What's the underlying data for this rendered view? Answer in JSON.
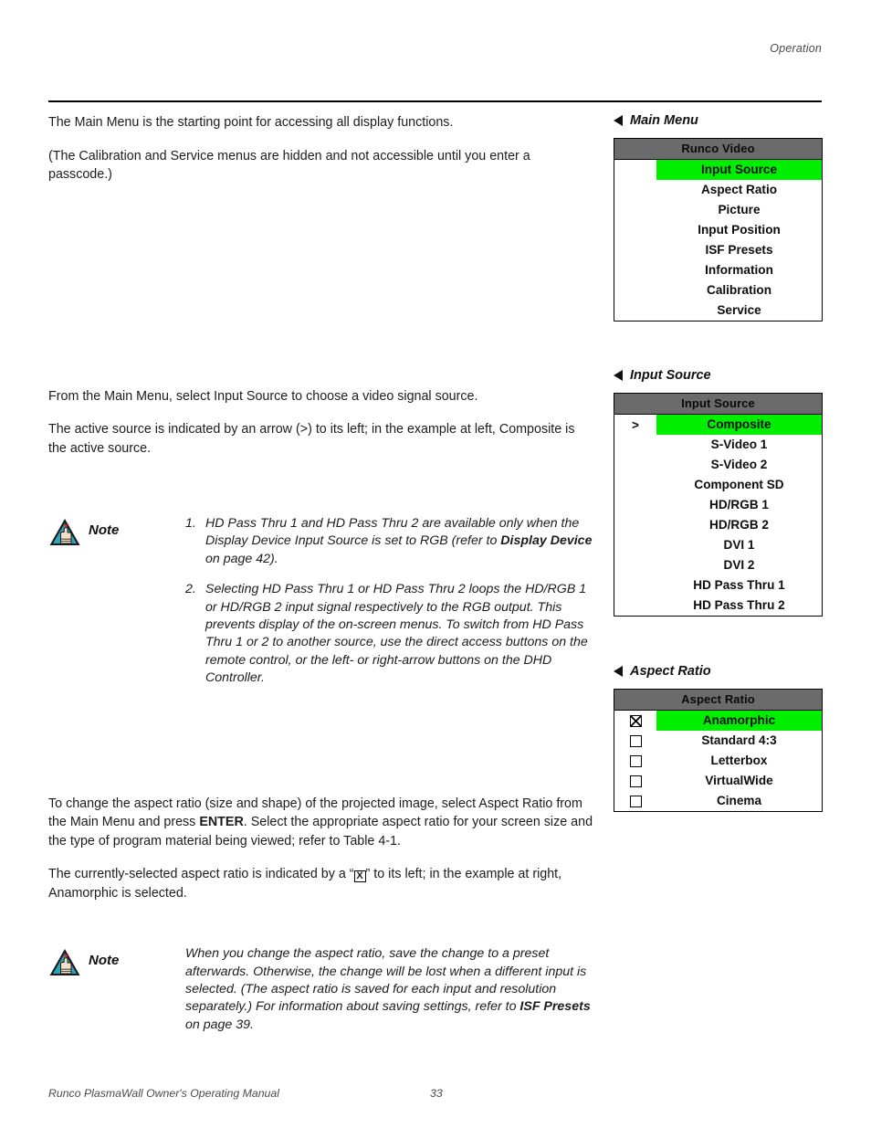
{
  "header": {
    "running_head": "Operation"
  },
  "footer": {
    "manual_title": "Runco PlasmaWall Owner's Operating Manual",
    "page_number": "33"
  },
  "left_column": {
    "para_main_menu_1": "The Main Menu is the starting point for accessing all display functions.",
    "para_main_menu_2": "(The Calibration and Service menus are hidden and not accessible until you enter a passcode.)",
    "para_input_source_1": "From the Main Menu, select Input Source to choose a video signal source.",
    "para_input_source_2": "The active source is indicated by an arrow (>) to its left; in the example at left, Composite is the active source.",
    "note_input_source": {
      "label": "Note",
      "items": [
        {
          "number": "1.",
          "text_before": "HD Pass Thru 1 and HD Pass Thru 2 are available only when the Display Device Input Source is set to RGB (refer to ",
          "bold": "Display Device",
          "text_after": " on page 42)."
        },
        {
          "number": "2.",
          "text_before": "Selecting HD Pass Thru 1 or HD Pass Thru 2 loops the HD/RGB 1 or HD/RGB 2 input signal respectively to the RGB output. This prevents display of the on-screen menus. To switch from HD Pass Thru 1 or 2 to another source, use the direct access buttons on the remote control, or the left- or right-arrow buttons on the DHD Controller.",
          "bold": "",
          "text_after": ""
        }
      ]
    },
    "para_aspect_1_a": "To change the aspect ratio (size and shape) of the projected image, select Aspect Ratio from the Main Menu and press ",
    "para_aspect_1_bold": "ENTER",
    "para_aspect_1_b": ". Select the appropriate aspect ratio for your screen size and the type of program material being viewed; refer to Table 4-1.",
    "para_aspect_2_a": "The currently-selected aspect ratio is indicated by a “",
    "para_aspect_2_glyph": "X",
    "para_aspect_2_b": "” to its left; in the example at right, Anamorphic is selected.",
    "note_aspect": {
      "label": "Note",
      "text_before": "When you change the aspect ratio, save the change to a preset afterwards. Otherwise, the change will be lost when a different input is selected. (The aspect ratio is saved for each input and resolution separately.) For information about saving settings, refer to ",
      "bold": "ISF Presets",
      "text_after": " on page 39."
    }
  },
  "right_column": {
    "colors": {
      "title_bar": "#6b6b6b",
      "highlight": "#00ee00",
      "border": "#000000"
    },
    "sections": [
      {
        "heading": "Main Menu",
        "menu_title": "Runco Video",
        "gutter_type": "none",
        "rows": [
          {
            "gutter": "",
            "label": "Input Source",
            "selected": true
          },
          {
            "gutter": "",
            "label": "Aspect Ratio",
            "selected": false
          },
          {
            "gutter": "",
            "label": "Picture",
            "selected": false
          },
          {
            "gutter": "",
            "label": "Input Position",
            "selected": false
          },
          {
            "gutter": "",
            "label": "ISF Presets",
            "selected": false
          },
          {
            "gutter": "",
            "label": "Information",
            "selected": false
          },
          {
            "gutter": "",
            "label": "Calibration",
            "selected": false
          },
          {
            "gutter": "",
            "label": "Service",
            "selected": false
          }
        ]
      },
      {
        "heading": "Input Source",
        "menu_title": "Input Source",
        "gutter_type": "arrow",
        "rows": [
          {
            "gutter": ">",
            "label": "Composite",
            "selected": true
          },
          {
            "gutter": "",
            "label": "S-Video 1",
            "selected": false
          },
          {
            "gutter": "",
            "label": "S-Video 2",
            "selected": false
          },
          {
            "gutter": "",
            "label": "Component SD",
            "selected": false
          },
          {
            "gutter": "",
            "label": "HD/RGB 1",
            "selected": false
          },
          {
            "gutter": "",
            "label": "HD/RGB 2",
            "selected": false
          },
          {
            "gutter": "",
            "label": "DVI 1",
            "selected": false
          },
          {
            "gutter": "",
            "label": "DVI 2",
            "selected": false
          },
          {
            "gutter": "",
            "label": "HD Pass Thru 1",
            "selected": false
          },
          {
            "gutter": "",
            "label": "HD Pass Thru 2",
            "selected": false
          }
        ]
      },
      {
        "heading": "Aspect Ratio",
        "menu_title": "Aspect Ratio",
        "gutter_type": "checkbox",
        "rows": [
          {
            "gutter": "checked",
            "label": "Anamorphic",
            "selected": true
          },
          {
            "gutter": "unchecked",
            "label": "Standard 4:3",
            "selected": false
          },
          {
            "gutter": "unchecked",
            "label": "Letterbox",
            "selected": false
          },
          {
            "gutter": "unchecked",
            "label": "VirtualWide",
            "selected": false
          },
          {
            "gutter": "unchecked",
            "label": "Cinema",
            "selected": false
          }
        ]
      }
    ]
  }
}
